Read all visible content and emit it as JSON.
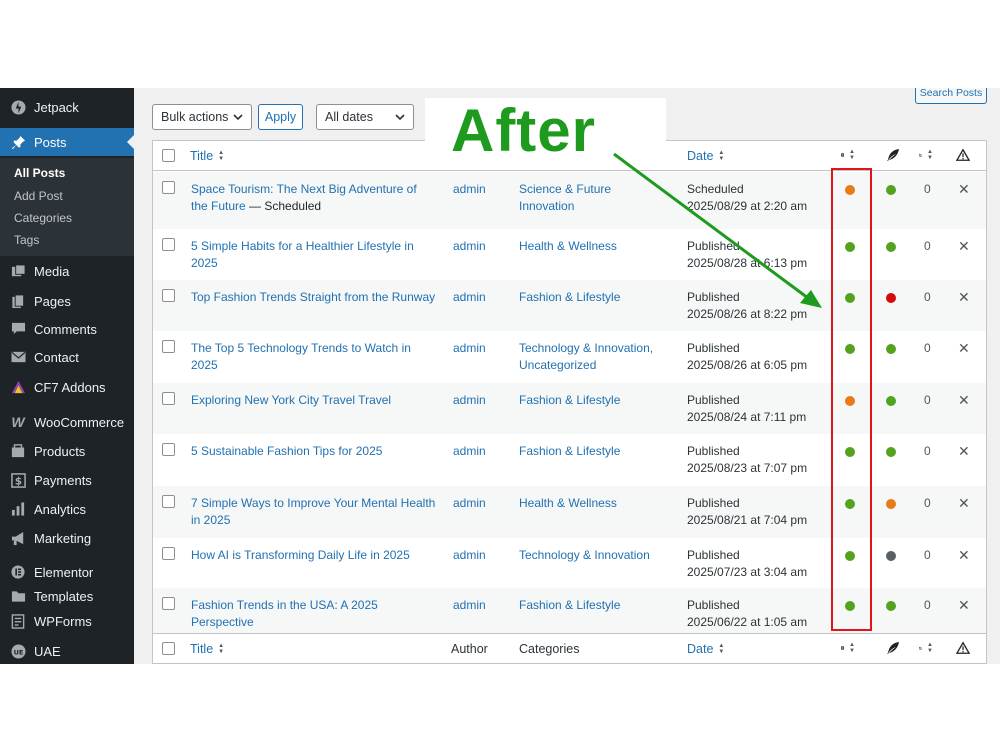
{
  "overlay": {
    "after_label": "After",
    "arrow_color": "#1e9b1e",
    "highlight_color": "#e0141c"
  },
  "sidebar": {
    "items": [
      {
        "label": "Jetpack",
        "icon": "jetpack-icon"
      },
      {
        "label": "Posts",
        "icon": "pushpin-icon",
        "active": true
      },
      {
        "label": "Media",
        "icon": "media-icon"
      },
      {
        "label": "Pages",
        "icon": "pages-icon"
      },
      {
        "label": "Comments",
        "icon": "comment-icon"
      },
      {
        "label": "Contact",
        "icon": "envelope-icon"
      },
      {
        "label": "CF7 Addons",
        "icon": "cf7-icon"
      },
      {
        "label": "WooCommerce",
        "icon": "woocommerce-icon"
      },
      {
        "label": "Products",
        "icon": "products-icon"
      },
      {
        "label": "Payments",
        "icon": "dollar-icon"
      },
      {
        "label": "Analytics",
        "icon": "bar-chart-icon"
      },
      {
        "label": "Marketing",
        "icon": "megaphone-icon"
      },
      {
        "label": "Elementor",
        "icon": "elementor-icon"
      },
      {
        "label": "Templates",
        "icon": "folder-icon"
      },
      {
        "label": "WPForms",
        "icon": "wpforms-icon"
      },
      {
        "label": "UAE",
        "icon": "uae-icon"
      }
    ],
    "submenu": [
      "All Posts",
      "Add Post",
      "Categories",
      "Tags"
    ]
  },
  "toolbar": {
    "bulk_actions": "Bulk actions",
    "apply": "Apply",
    "all_dates": "All dates",
    "search_posts": "Search Posts"
  },
  "columns": {
    "title": "Title",
    "author": "Author",
    "categories": "Categories",
    "date": "Date"
  },
  "colors": {
    "green": "#53a31f",
    "orange": "#e87a1a",
    "red": "#d50b0b",
    "gray": "#5a5f63",
    "link": "#2271b1"
  },
  "posts": [
    {
      "title": "Space Tourism: The Next Big Adventure of the Future",
      "state": " — Scheduled",
      "author": "admin",
      "categories": "Science & Future Innovation",
      "status": "Scheduled",
      "date": "2025/08/29 at 2:20 am",
      "dot1": "orange",
      "dot2": "green",
      "count": "0"
    },
    {
      "title": "5 Simple Habits for a Healthier Lifestyle in 2025",
      "state": "",
      "author": "admin",
      "categories": "Health & Wellness",
      "status": "Published",
      "date": "2025/08/28 at 6:13 pm",
      "dot1": "green",
      "dot2": "green",
      "count": "0"
    },
    {
      "title": "Top Fashion Trends Straight from the Runway",
      "state": "",
      "author": "admin",
      "categories": "Fashion & Lifestyle",
      "status": "Published",
      "date": "2025/08/26 at 8:22 pm",
      "dot1": "green",
      "dot2": "red",
      "count": "0"
    },
    {
      "title": "The Top 5 Technology Trends to Watch in 2025",
      "state": "",
      "author": "admin",
      "categories": "Technology & Innovation, Uncategorized",
      "status": "Published",
      "date": "2025/08/26 at 6:05 pm",
      "dot1": "green",
      "dot2": "green",
      "count": "0"
    },
    {
      "title": "Exploring New York City Travel Travel",
      "state": "",
      "author": "admin",
      "categories": "Fashion & Lifestyle",
      "status": "Published",
      "date": "2025/08/24 at 7:11 pm",
      "dot1": "orange",
      "dot2": "green",
      "count": "0"
    },
    {
      "title": "5 Sustainable Fashion Tips for 2025",
      "state": "",
      "author": "admin",
      "categories": "Fashion & Lifestyle",
      "status": "Published",
      "date": "2025/08/23 at 7:07 pm",
      "dot1": "green",
      "dot2": "green",
      "count": "0"
    },
    {
      "title": "7 Simple Ways to Improve Your Mental Health in 2025",
      "state": "",
      "author": "admin",
      "categories": "Health & Wellness",
      "status": "Published",
      "date": "2025/08/21 at 7:04 pm",
      "dot1": "green",
      "dot2": "orange",
      "count": "0"
    },
    {
      "title": "How AI is Transforming Daily Life in 2025",
      "state": "",
      "author": "admin",
      "categories": "Technology & Innovation",
      "status": "Published",
      "date": "2025/07/23 at 3:04 am",
      "dot1": "green",
      "dot2": "gray",
      "count": "0"
    },
    {
      "title": "Fashion Trends in the USA: A 2025 Perspective",
      "state": "",
      "author": "admin",
      "categories": "Fashion & Lifestyle",
      "status": "Published",
      "date": "2025/06/22 at 1:05 am",
      "dot1": "green",
      "dot2": "green",
      "count": "0"
    }
  ]
}
